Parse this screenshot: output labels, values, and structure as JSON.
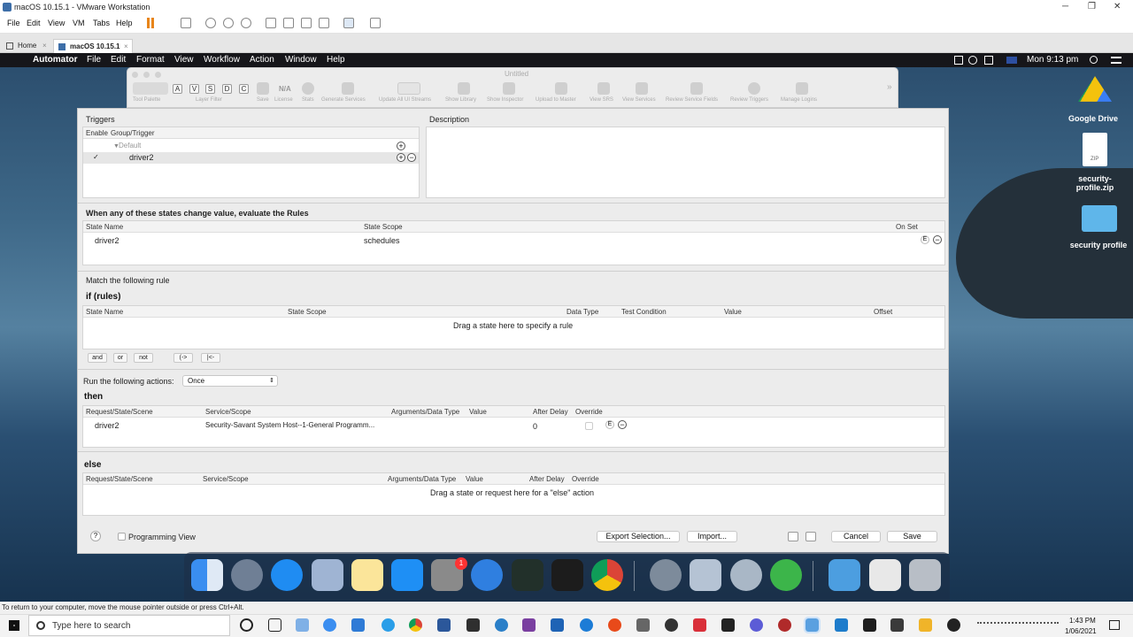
{
  "vm": {
    "title": "macOS 10.15.1 - VMware Workstation",
    "menu": [
      "File",
      "Edit",
      "View",
      "VM",
      "Tabs",
      "Help"
    ],
    "tabs": [
      "Home",
      "macOS 10.15.1"
    ],
    "status_hint": "To return to your computer, move the mouse pointer outside or press Ctrl+Alt."
  },
  "mac_menu": {
    "app": "Automator",
    "items": [
      "File",
      "Edit",
      "Format",
      "View",
      "Workflow",
      "Action",
      "Window",
      "Help"
    ],
    "clock": "Mon 9:13 pm"
  },
  "automator": {
    "title": "Untitled",
    "toolbar_letters": [
      "A",
      "V",
      "S",
      "D",
      "C"
    ],
    "na": "N/A",
    "labels": [
      "Tool Palette",
      "Layer Filter",
      "Save",
      "License",
      "Stats",
      "Generate Services",
      "Update All UI Streams",
      "Show Library",
      "Show Inspector",
      "Upload to Master",
      "View SRS",
      "View Services",
      "Review Service Fields",
      "Review Triggers",
      "Manage Logins"
    ]
  },
  "triggers": {
    "title": "Triggers",
    "col_enable": "Enable",
    "col_group": "Group/Trigger",
    "group": "Default",
    "item": "driver2",
    "item_checked": "✓"
  },
  "description": {
    "title": "Description"
  },
  "states": {
    "title": "When any of these states change value, evaluate the Rules",
    "cols": [
      "State Name",
      "State Scope",
      "On Set"
    ],
    "row": {
      "name": "driver2",
      "scope": "schedules",
      "e": "E"
    }
  },
  "rules": {
    "match": "Match the following rule",
    "if": "if (rules)",
    "cols": [
      "State Name",
      "State Scope",
      "Data Type",
      "Test Condition",
      "Value",
      "Offset"
    ],
    "placeholder": "Drag a state here to specify a rule",
    "ops": [
      "and",
      "or",
      "not",
      "(->",
      "|<-"
    ]
  },
  "run": {
    "label": "Run the following actions:",
    "select": "Once"
  },
  "then": {
    "title": "then",
    "cols": [
      "Request/State/Scene",
      "Service/Scope",
      "Arguments/Data Type",
      "Value",
      "After Delay",
      "Override"
    ],
    "row": {
      "name": "driver2",
      "service": "Security-Savant System Host--1-General Programm...",
      "delay": "0",
      "e": "E"
    }
  },
  "else": {
    "title": "else",
    "cols": [
      "Request/State/Scene",
      "Service/Scope",
      "Arguments/Data Type",
      "Value",
      "After Delay",
      "Override"
    ],
    "placeholder": "Drag a state or request here for a \"else\" action"
  },
  "footer": {
    "help": "?",
    "programming_view": "Programming View",
    "export": "Export Selection...",
    "import": "Import...",
    "cancel": "Cancel",
    "save": "Save"
  },
  "desktop": {
    "icons": [
      "Google Drive",
      "security-profile.zip",
      "security profile"
    ],
    "zip_badge": "ZIP"
  },
  "dock": {
    "badge": "1"
  },
  "taskbar": {
    "search_placeholder": "Type here to search",
    "time": "1:43 PM",
    "date": "1/06/2021"
  }
}
